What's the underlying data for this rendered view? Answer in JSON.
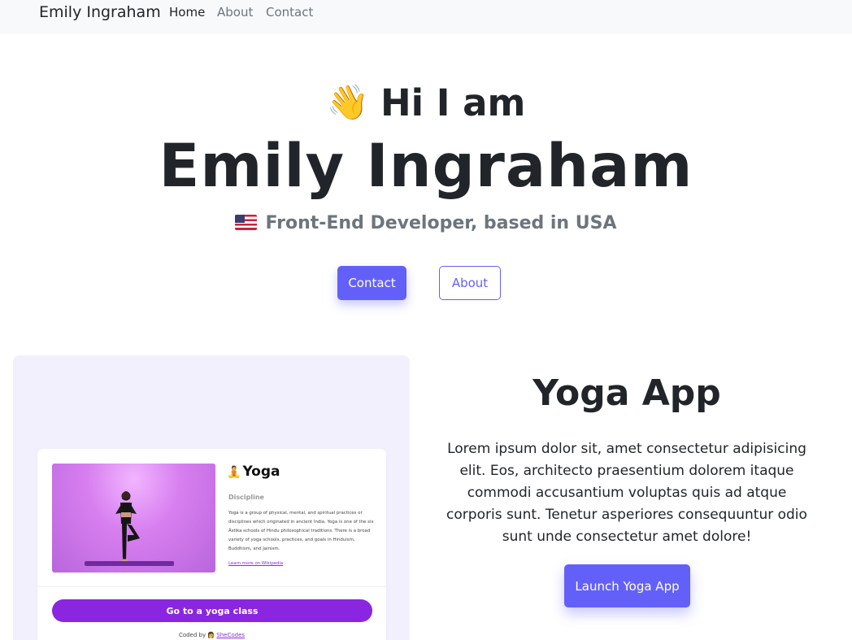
{
  "navbar": {
    "brand": "Emily Ingraham",
    "links": [
      {
        "label": "Home",
        "active": true
      },
      {
        "label": "About",
        "active": false
      },
      {
        "label": "Contact",
        "active": false
      }
    ]
  },
  "hero": {
    "wave_emoji": "👋",
    "greeting": "Hi I am",
    "name": "Emily Ingraham",
    "flag_icon": "us-flag-icon",
    "subtitle": "Front-End Developer, based in USA",
    "contact_button": "Contact",
    "about_button": "About"
  },
  "project": {
    "title": "Yoga App",
    "description": "Lorem ipsum dolor sit, amet consectetur adipisicing elit. Eos, architecto praesentium dolorem itaque commodi accusantium voluptas quis ad atque corporis sunt. Tenetur asperiores consequuntur odio sunt unde consectetur amet dolore!",
    "launch_button": "Launch Yoga App",
    "preview": {
      "app_title": "Yoga",
      "app_emoji": "🧘",
      "section_label": "Discipline",
      "body_text": "Yoga is a group of physical, mental, and spiritual practices or disciplines which originated in ancient India. Yoga is one of the six Āstika schools of Hindu philosophical traditions. There is a broad variety of yoga schools, practices, and goals in Hinduism, Buddhism, and Jainism.",
      "learn_more": "Learn more on Wikipedia",
      "cta": "Go to a yoga class",
      "footer_prefix": "Coded by 👩 ",
      "footer_link": "SheCodes"
    }
  },
  "colors": {
    "accent": "#6360fa",
    "preview_purple": "#8a26e0",
    "navbar_bg": "#f8f9fa",
    "preview_bg": "#f3f0fe"
  }
}
